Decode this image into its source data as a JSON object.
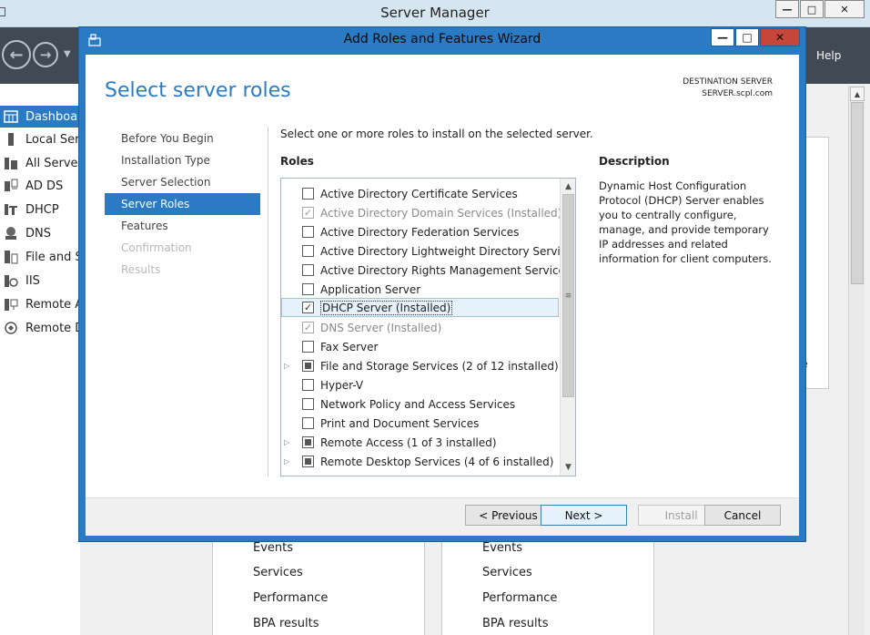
{
  "server_manager": {
    "title": "Server Manager",
    "controls": {
      "minimize": "—",
      "maximize": "□",
      "close": "✕"
    },
    "nav": {
      "back_icon": "←",
      "forward_icon": "→",
      "dropdown_icon": "▼",
      "help": "Help"
    },
    "sidebar": [
      {
        "label": "Dashboard",
        "icon": "dashboard-icon"
      },
      {
        "label": "Local Server",
        "icon": "server-icon"
      },
      {
        "label": "All Servers",
        "icon": "servers-icon"
      },
      {
        "label": "AD DS",
        "icon": "adds-icon"
      },
      {
        "label": "DHCP",
        "icon": "dhcp-icon"
      },
      {
        "label": "DNS",
        "icon": "dns-icon"
      },
      {
        "label": "File and Storage Services",
        "icon": "file-storage-icon"
      },
      {
        "label": "IIS",
        "icon": "iis-icon"
      },
      {
        "label": "Remote Access",
        "icon": "remote-access-icon"
      },
      {
        "label": "Remote Desktop Services",
        "icon": "remote-desktop-icon"
      }
    ],
    "tiles": [
      {
        "links": [
          "Events",
          "Services",
          "Performance",
          "BPA results"
        ]
      },
      {
        "links": [
          "Events",
          "Services",
          "Performance",
          "BPA results"
        ]
      }
    ],
    "panel_fragment": "e",
    "scroll_up": "▲"
  },
  "wizard": {
    "title": "Add Roles and Features Wizard",
    "controls": {
      "minimize": "—",
      "maximize": "□",
      "close": "✕"
    },
    "heading": "Select server roles",
    "destination_label": "DESTINATION SERVER",
    "destination_server": "SERVER.scpl.com",
    "steps": [
      {
        "label": "Before You Begin",
        "state": "normal"
      },
      {
        "label": "Installation Type",
        "state": "normal"
      },
      {
        "label": "Server Selection",
        "state": "normal"
      },
      {
        "label": "Server Roles",
        "state": "active"
      },
      {
        "label": "Features",
        "state": "normal"
      },
      {
        "label": "Confirmation",
        "state": "disabled"
      },
      {
        "label": "Results",
        "state": "disabled"
      }
    ],
    "instruction": "Select one or more roles to install on the selected server.",
    "roles_label": "Roles",
    "roles": [
      {
        "label": "Active Directory Certificate Services",
        "state": "unchecked",
        "expandable": false,
        "dim": false
      },
      {
        "label": "Active Directory Domain Services (Installed)",
        "state": "checked",
        "expandable": false,
        "dim": true
      },
      {
        "label": "Active Directory Federation Services",
        "state": "unchecked",
        "expandable": false,
        "dim": false
      },
      {
        "label": "Active Directory Lightweight Directory Services",
        "state": "unchecked",
        "expandable": false,
        "dim": false
      },
      {
        "label": "Active Directory Rights Management Services",
        "state": "unchecked",
        "expandable": false,
        "dim": false
      },
      {
        "label": "Application Server",
        "state": "unchecked",
        "expandable": false,
        "dim": false
      },
      {
        "label": "DHCP Server (Installed)",
        "state": "checked",
        "expandable": false,
        "dim": false,
        "selected": true
      },
      {
        "label": "DNS Server (Installed)",
        "state": "checked",
        "expandable": false,
        "dim": true
      },
      {
        "label": "Fax Server",
        "state": "unchecked",
        "expandable": false,
        "dim": false
      },
      {
        "label": "File and Storage Services (2 of 12 installed)",
        "state": "partial",
        "expandable": true,
        "dim": false
      },
      {
        "label": "Hyper-V",
        "state": "unchecked",
        "expandable": false,
        "dim": false
      },
      {
        "label": "Network Policy and Access Services",
        "state": "unchecked",
        "expandable": false,
        "dim": false
      },
      {
        "label": "Print and Document Services",
        "state": "unchecked",
        "expandable": false,
        "dim": false
      },
      {
        "label": "Remote Access (1 of 3 installed)",
        "state": "partial",
        "expandable": true,
        "dim": false
      },
      {
        "label": "Remote Desktop Services (4 of 6 installed)",
        "state": "partial",
        "expandable": true,
        "dim": false
      }
    ],
    "roles_scroll": {
      "up": "▲",
      "down": "▼",
      "grip": "≡"
    },
    "description_label": "Description",
    "description": "Dynamic Host Configuration Protocol (DHCP) Server enables you to centrally configure, manage, and provide temporary IP addresses and related information for client computers.",
    "buttons": {
      "previous": "< Previous",
      "next": "Next >",
      "install": "Install",
      "cancel": "Cancel"
    }
  },
  "colors": {
    "accent": "#2a7bc4",
    "nav_bar": "#3f4a55",
    "close_button": "#c7463a"
  }
}
